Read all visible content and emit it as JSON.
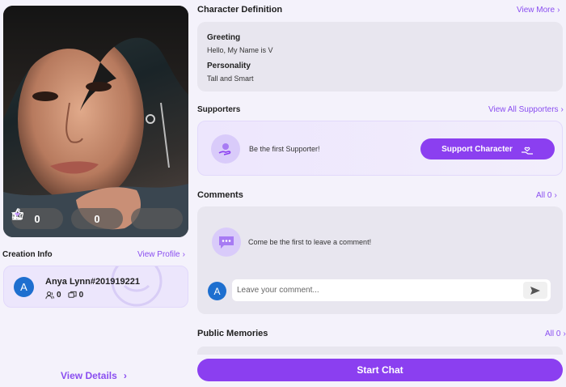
{
  "character": {
    "photo_alt": "Character portrait",
    "likes": "0",
    "favorites": "0",
    "like_icon": "thumbs-up-icon",
    "favorite_icon": "star-icon",
    "gift_icon": "gift-heart-icon"
  },
  "creation_info": {
    "title": "Creation Info",
    "view_profile": "View Profile",
    "avatar_letter": "A",
    "creator_name": "Anya Lynn#201919221",
    "followers": "0",
    "characters": "0"
  },
  "view_details": "View Details",
  "definition": {
    "title": "Character Definition",
    "view_more": "View More",
    "greeting_label": "Greeting",
    "greeting_text": "Hello, My Name is V",
    "personality_label": "Personality",
    "personality_text": "Tall and Smart"
  },
  "supporters": {
    "title": "Supporters",
    "view_all": "View All Supporters",
    "empty_text": "Be the first Supporter!",
    "support_button": "Support Character"
  },
  "comments": {
    "title": "Comments",
    "all_link": "All 0",
    "empty_text": "Come be the first to leave a comment!",
    "user_avatar_letter": "A",
    "input_placeholder": "Leave your comment..."
  },
  "memories": {
    "title": "Public Memories",
    "all_link": "All 0"
  },
  "start_chat": "Start Chat",
  "colors": {
    "accent": "#8b3ff0",
    "link": "#8a4ef0",
    "avatar": "#1e6fcf"
  }
}
